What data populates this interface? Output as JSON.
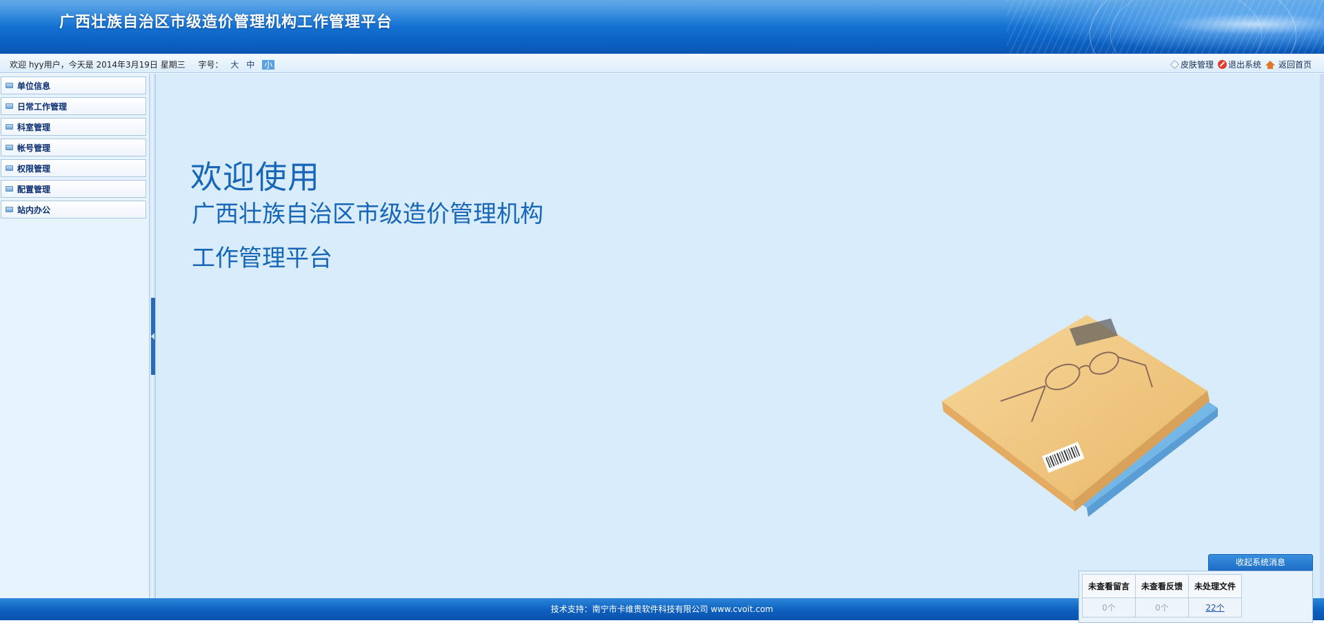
{
  "header": {
    "title": "广西壮族自治区市级造价管理机构工作管理平台"
  },
  "infobar": {
    "welcome": "欢迎 hyy用户，今天是 2014年3月19日 星期三",
    "font_size_label": "字号：",
    "font_sizes": [
      "大",
      "中",
      "小"
    ],
    "active_font_size": "小",
    "links": [
      {
        "label": "皮肤管理",
        "icon": "skin-icon"
      },
      {
        "label": "退出系统",
        "icon": "exit-icon"
      },
      {
        "label": "返回首页",
        "icon": "home-icon"
      }
    ]
  },
  "sidebar": {
    "items": [
      {
        "label": "单位信息"
      },
      {
        "label": "日常工作管理"
      },
      {
        "label": "科室管理"
      },
      {
        "label": "帐号管理"
      },
      {
        "label": "权限管理"
      },
      {
        "label": "配置管理"
      },
      {
        "label": "站内办公"
      }
    ]
  },
  "main": {
    "welcome": "欢迎使用",
    "org": "广西壮族自治区市级造价管理机构",
    "platform": "工作管理平台"
  },
  "message_panel": {
    "toggle_label": "收起系统消息",
    "headers": [
      "未查看留言",
      "未查看反馈",
      "未处理文件"
    ],
    "values": [
      "0个",
      "0个",
      "22个"
    ]
  },
  "footer": {
    "text": "技术支持：南宁市卡维贵软件科技有限公司  www.cvoit.com"
  },
  "colors": {
    "brand_blue": "#0c62c4",
    "main_bg": "#d8ecfb",
    "title_text": "#1766b8"
  }
}
